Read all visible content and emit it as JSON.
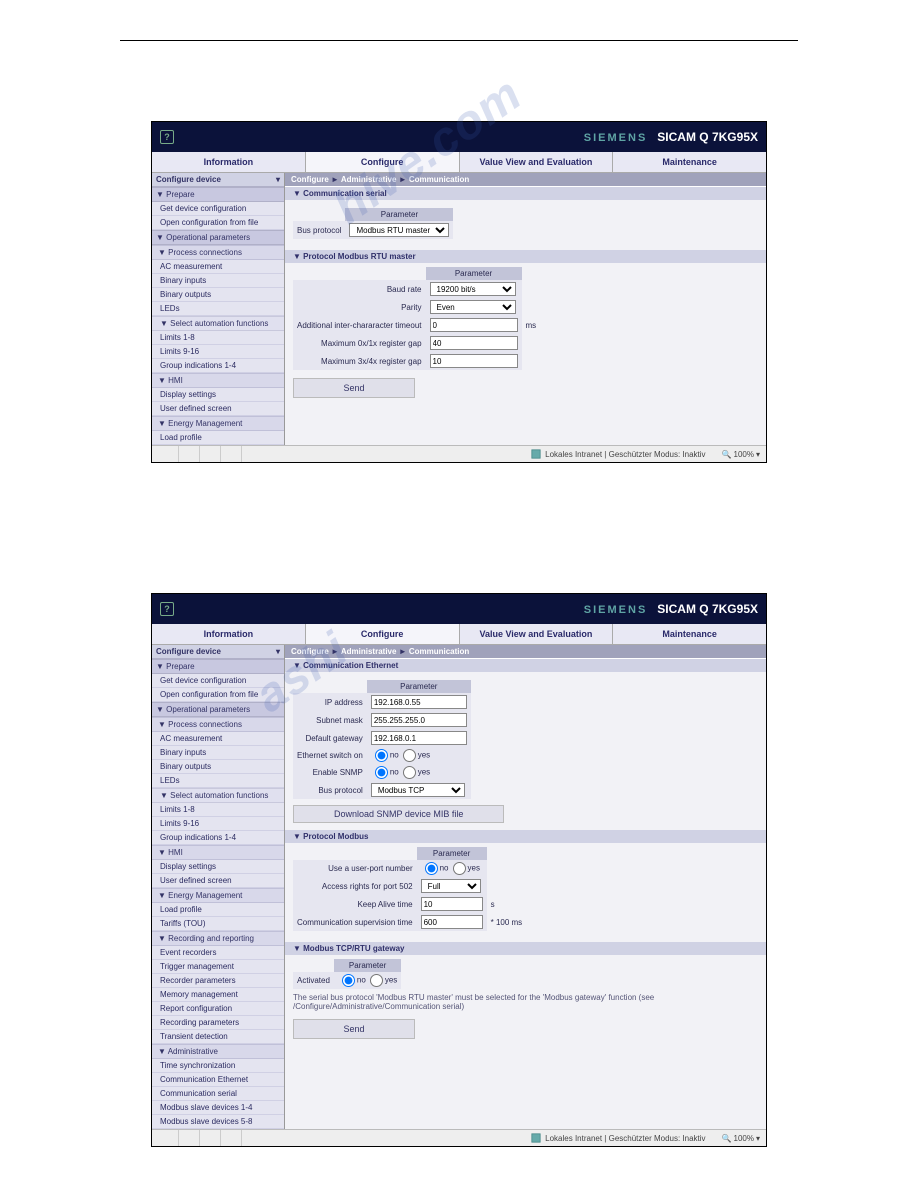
{
  "branding": {
    "siemens": "SIEMENS",
    "product": "SICAM Q 7KG95X"
  },
  "tabs": {
    "t0": "Information",
    "t1": "Configure",
    "t2": "Value View and Evaluation",
    "t3": "Maintenance"
  },
  "breadcrumb": {
    "a": "Configure",
    "b": "Administrative",
    "c": "Communication",
    "sep": "►"
  },
  "panel1": {
    "sidebar": {
      "head": "Configure device",
      "prepare": "▼ Prepare",
      "i_getdev": "Get device configuration",
      "i_openfile": "Open configuration from file",
      "op": "▼ Operational parameters",
      "proc": "▼ Process connections",
      "i_ac": "AC measurement",
      "i_bin": "Binary inputs",
      "i_bout": "Binary outputs",
      "i_leds": "LEDs",
      "auto": "▼ Select automation functions",
      "i_l18": "Limits 1-8",
      "i_l916": "Limits 9-16",
      "i_grp": "Group indications 1-4",
      "hmi": "▼ HMI",
      "i_disp": "Display settings",
      "i_uds": "User defined screen",
      "em": "▼ Energy Management",
      "i_lp": "Load profile"
    },
    "sec_serial": "▼ Communication serial",
    "tbl1": {
      "hd_param": "Parameter",
      "lbl_busprot": "Bus protocol",
      "val_busprot": "Modbus RTU master"
    },
    "sec_prot": "▼ Protocol Modbus RTU master",
    "tbl2": {
      "hd_param": "Parameter",
      "lbl_baud": "Baud rate",
      "val_baud": "19200 bit/s",
      "lbl_parity": "Parity",
      "val_parity": "Even",
      "lbl_timeout": "Additional inter-chararacter timeout",
      "val_timeout": "0",
      "unit_timeout": "ms",
      "lbl_gap01": "Maximum 0x/1x register gap",
      "val_gap01": "40",
      "lbl_gap34": "Maximum 3x/4x register gap",
      "val_gap34": "10"
    },
    "btn_send": "Send"
  },
  "panel2": {
    "sidebar": {
      "head": "Configure device",
      "prepare": "▼ Prepare",
      "i_getdev": "Get device configuration",
      "i_openfile": "Open configuration from file",
      "op": "▼ Operational parameters",
      "proc": "▼ Process connections",
      "i_ac": "AC measurement",
      "i_bin": "Binary inputs",
      "i_bout": "Binary outputs",
      "i_leds": "LEDs",
      "auto": "▼ Select automation functions",
      "i_l18": "Limits 1-8",
      "i_l916": "Limits 9-16",
      "i_grp": "Group indications 1-4",
      "hmi": "▼ HMI",
      "i_disp": "Display settings",
      "i_uds": "User defined screen",
      "em": "▼ Energy Management",
      "i_lp": "Load profile",
      "i_tou": "Tariffs (TOU)",
      "rec": "▼ Recording and reporting",
      "i_evrec": "Event recorders",
      "i_trig": "Trigger management",
      "i_recp": "Recorder parameters",
      "i_mem": "Memory management",
      "i_repc": "Report configuration",
      "i_recpa": "Recording parameters",
      "i_trans": "Transient detection",
      "admin": "▼ Administrative",
      "i_ts": "Time synchronization",
      "i_ce": "Communication Ethernet",
      "i_cs": "Communication serial",
      "i_ms14": "Modbus slave devices 1-4",
      "i_ms58": "Modbus slave devices 5-8"
    },
    "sec_eth": "▼ Communication Ethernet",
    "tbl_eth": {
      "hd_param": "Parameter",
      "lbl_ip": "IP address",
      "val_ip": "192.168.0.55",
      "lbl_mask": "Subnet mask",
      "val_mask": "255.255.255.0",
      "lbl_gw": "Default gateway",
      "val_gw": "192.168.0.1",
      "lbl_ethsw": "Ethernet switch on",
      "lbl_snmp": "Enable SNMP",
      "lbl_busprot": "Bus protocol",
      "val_busprot": "Modbus TCP"
    },
    "radio": {
      "no": "no",
      "yes": "yes"
    },
    "btn_mib": "Download SNMP device MIB file",
    "sec_mod": "▼ Protocol Modbus",
    "tbl_mod": {
      "hd_param": "Parameter",
      "lbl_userport": "Use a user-port number",
      "lbl_access": "Access rights for port 502",
      "val_access": "Full",
      "lbl_keep": "Keep Alive time",
      "val_keep": "10",
      "unit_keep": "s",
      "lbl_comm": "Communication supervision time",
      "val_comm": "600",
      "unit_comm": "* 100 ms"
    },
    "sec_gw": "▼ Modbus TCP/RTU gateway",
    "tbl_gw": {
      "hd_param": "Parameter",
      "lbl_act": "Activated"
    },
    "note": "The serial bus protocol 'Modbus RTU master' must be selected for the 'Modbus gateway' function (see /Configure/Administrative/Communication serial)",
    "btn_send": "Send"
  },
  "status": {
    "text": "Lokales Intranet | Geschützter Modus: Inaktiv",
    "zoom": "100%"
  }
}
